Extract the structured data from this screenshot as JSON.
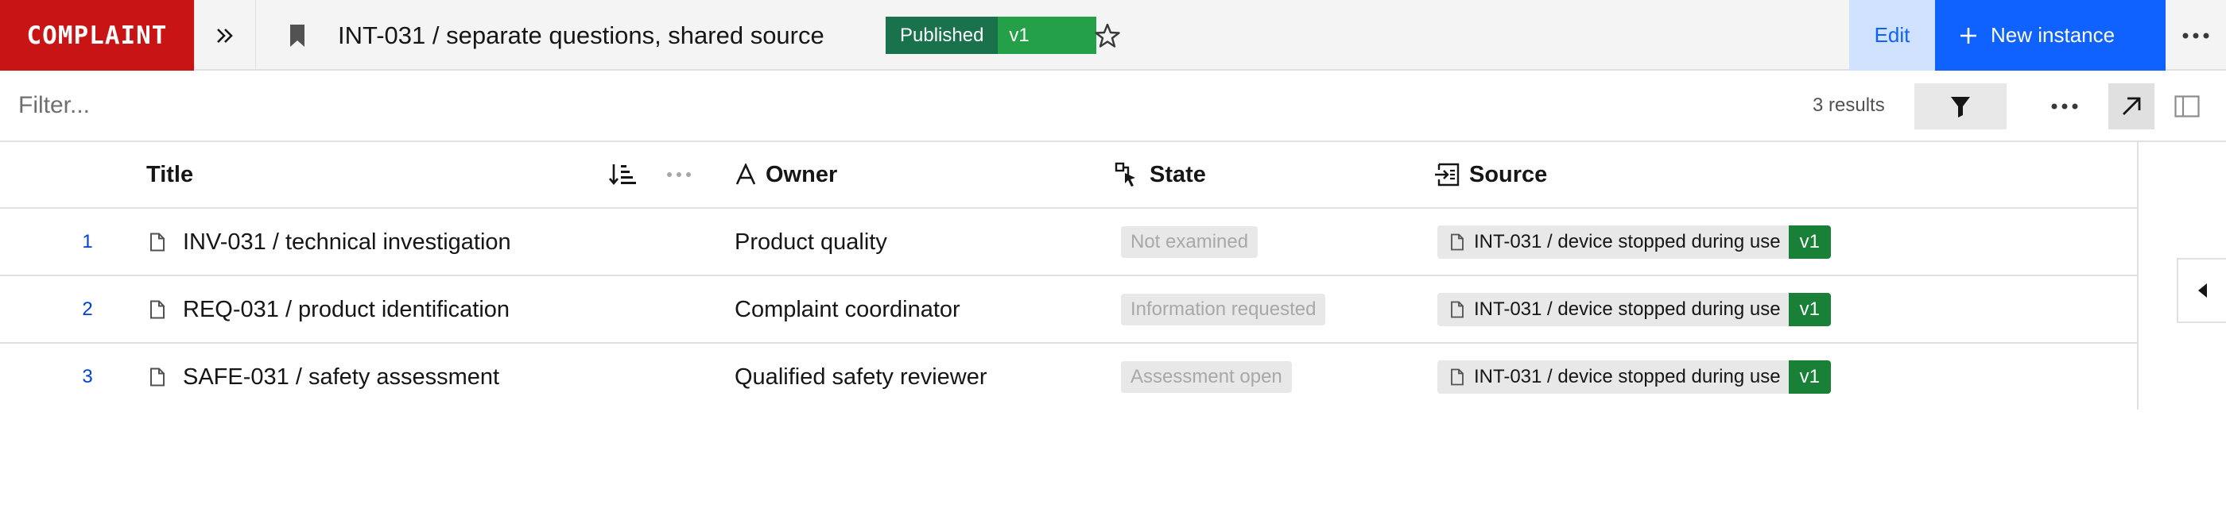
{
  "header": {
    "brand": "COMPLAINT",
    "title": "INT-031 / separate questions, shared source",
    "status": "Published",
    "version": "v1",
    "edit_label": "Edit",
    "new_instance_label": "New instance",
    "icons": {
      "expand": "chevron-double-right-icon",
      "bookmark": "bookmark-icon",
      "star": "star-icon",
      "more": "overflow-menu-icon",
      "add": "add-icon"
    }
  },
  "filterbar": {
    "placeholder": "Filter...",
    "results": "3 results",
    "icons": {
      "filter": "filter-icon",
      "more": "overflow-menu-icon",
      "open": "arrow-up-right-icon",
      "panel": "side-panel-icon"
    }
  },
  "table": {
    "columns": {
      "title": "Title",
      "owner": "Owner",
      "state": "State",
      "source": "Source"
    },
    "rows": [
      {
        "num": "1",
        "title": "INV-031 / technical investigation",
        "owner": "Product quality",
        "state": "Not examined",
        "source": "INT-031 / device stopped during use",
        "source_version": "v1"
      },
      {
        "num": "2",
        "title": "REQ-031 / product identification",
        "owner": "Complaint coordinator",
        "state": "Information requested",
        "source": "INT-031 / device stopped during use",
        "source_version": "v1"
      },
      {
        "num": "3",
        "title": "SAFE-031 / safety assessment",
        "owner": "Qualified safety reviewer",
        "state": "Assessment open",
        "source": "INT-031 / device stopped during use",
        "source_version": "v1"
      }
    ]
  },
  "colors": {
    "brand": "#c81414",
    "primary": "#0f62fe",
    "published": "#19724b",
    "version": "#198038"
  }
}
